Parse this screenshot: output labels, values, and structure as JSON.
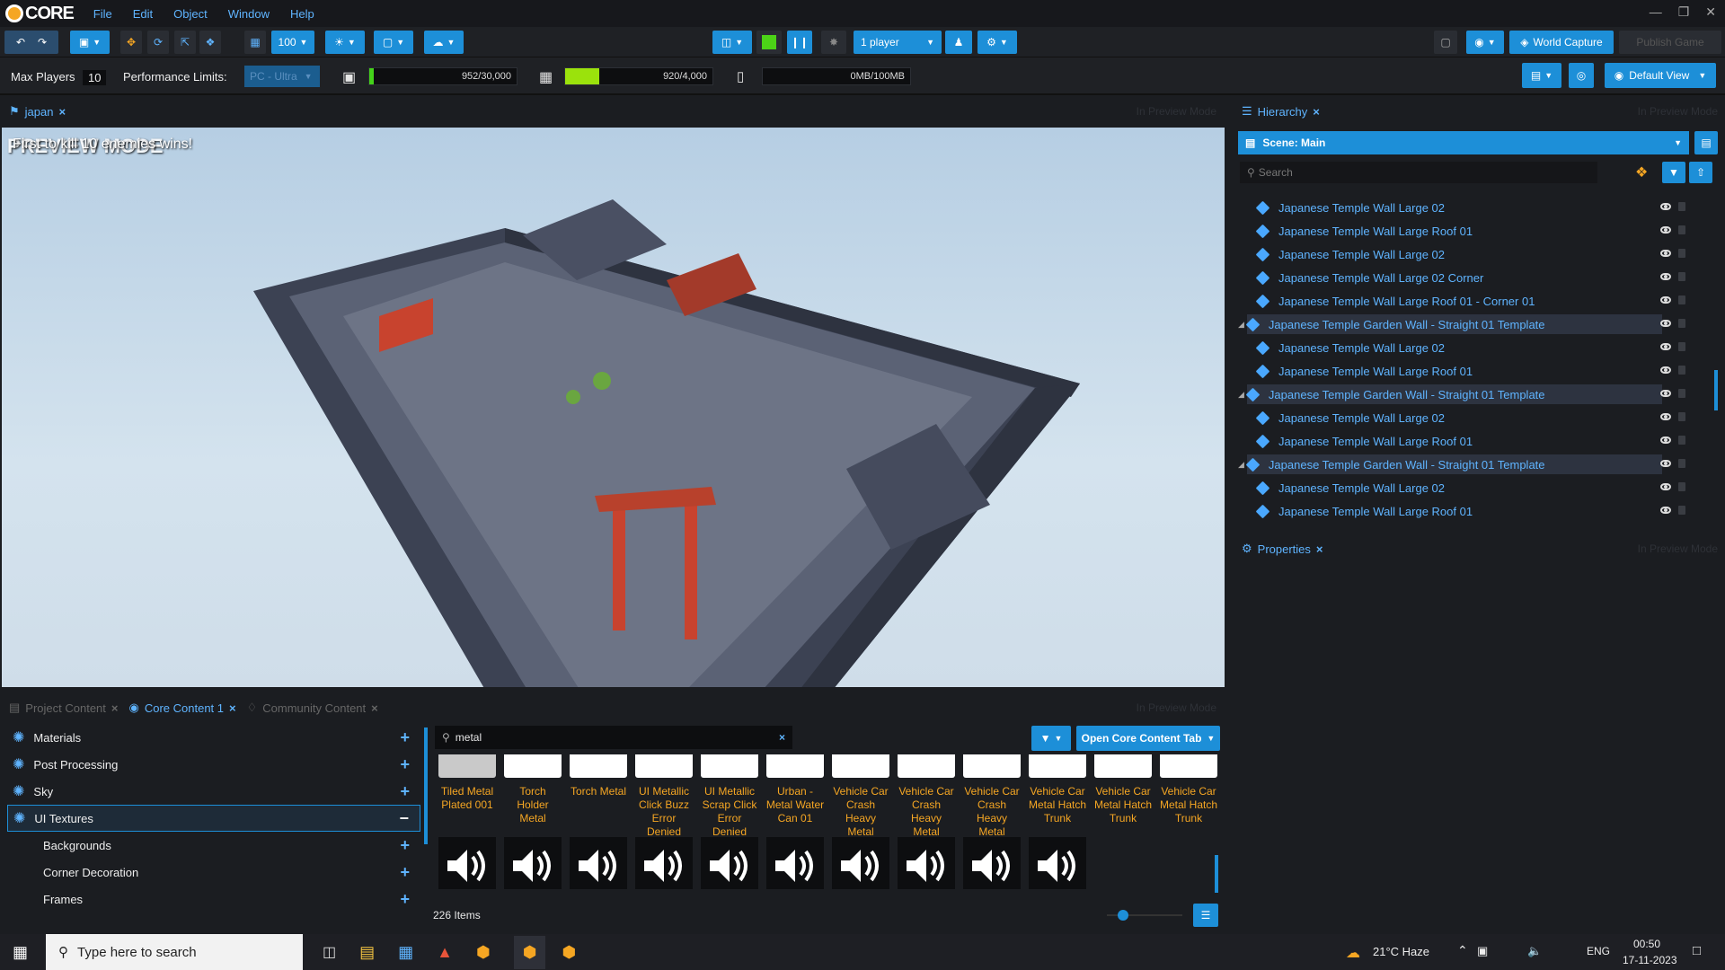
{
  "app": {
    "logo": "CORE",
    "menu": [
      "File",
      "Edit",
      "Object",
      "Window",
      "Help"
    ]
  },
  "toolbar": {
    "zoom": "100",
    "players": "1 player",
    "world_capture": "World Capture",
    "publish": "Publish Game",
    "default_view": "Default View"
  },
  "stats": {
    "max_players_label": "Max Players",
    "max_players": "10",
    "perf_label": "Performance Limits:",
    "perf_value": "PC - Ultra",
    "bars": [
      {
        "value": "952/30,000",
        "fraction": 0.032,
        "color": "#44d21a"
      },
      {
        "value": "920/4,000",
        "fraction": 0.23,
        "color": "#9be20c"
      },
      {
        "value": "0MB/100MB",
        "fraction": 0,
        "color": "#44d21a"
      }
    ]
  },
  "viewport": {
    "tab": "japan",
    "ghost": "In Preview Mode",
    "overlay": "PREVIEW MODE",
    "overlay2": "First to kill 10 enemies wins!"
  },
  "hierarchy": {
    "tab": "Hierarchy",
    "ghost": "In Preview Mode",
    "scene": "Scene: Main",
    "search_placeholder": "Search",
    "items": [
      {
        "label": "Japanese Temple Wall Large 02",
        "template": false
      },
      {
        "label": "Japanese Temple Wall Large Roof 01",
        "template": false
      },
      {
        "label": "Japanese Temple Wall Large 02",
        "template": false
      },
      {
        "label": "Japanese Temple Wall Large 02 Corner",
        "template": false
      },
      {
        "label": "Japanese Temple Wall Large Roof 01 - Corner 01",
        "template": false
      },
      {
        "label": "Japanese Temple Garden Wall - Straight 01 Template",
        "template": true
      },
      {
        "label": "Japanese Temple Wall Large 02",
        "template": false
      },
      {
        "label": "Japanese Temple Wall Large Roof 01",
        "template": false
      },
      {
        "label": "Japanese Temple Garden Wall - Straight 01 Template",
        "template": true
      },
      {
        "label": "Japanese Temple Wall Large 02",
        "template": false
      },
      {
        "label": "Japanese Temple Wall Large Roof 01",
        "template": false
      },
      {
        "label": "Japanese Temple Garden Wall - Straight 01 Template",
        "template": true
      },
      {
        "label": "Japanese Temple Wall Large 02",
        "template": false
      },
      {
        "label": "Japanese Temple Wall Large Roof 01",
        "template": false
      }
    ]
  },
  "properties": {
    "tab": "Properties",
    "ghost": "In Preview Mode"
  },
  "content": {
    "tabs": [
      "Project Content",
      "Core Content 1",
      "Community Content"
    ],
    "ghost": "In Preview Mode",
    "categories": [
      {
        "label": "Materials",
        "sign": "+",
        "indent": false
      },
      {
        "label": "Post Processing",
        "sign": "+",
        "indent": false
      },
      {
        "label": "Sky",
        "sign": "+",
        "indent": false
      },
      {
        "label": "UI Textures",
        "sign": "−",
        "indent": false
      },
      {
        "label": "Backgrounds",
        "sign": "+",
        "indent": true
      },
      {
        "label": "Corner Decoration",
        "sign": "+",
        "indent": true
      },
      {
        "label": "Frames",
        "sign": "+",
        "indent": true
      }
    ],
    "search_value": "metal",
    "open_tab": "Open Core Content Tab",
    "items_count": "226 Items",
    "tiles": [
      "Tiled Metal Plated 001",
      "Torch Holder Metal",
      "Torch Metal",
      "UI Metallic Click Buzz Error Denied",
      "UI Metallic Scrap Click Error Denied",
      "Urban - Metal Water Can 01",
      "Vehicle Car Crash Heavy Metal",
      "Vehicle Car Crash Heavy Metal",
      "Vehicle Car Crash Heavy Metal",
      "Vehicle Car Metal Hatch Trunk",
      "Vehicle Car Metal Hatch Trunk",
      "Vehicle Car Metal Hatch Trunk"
    ]
  },
  "taskbar": {
    "search": "Type here to search",
    "weather": "21°C  Haze",
    "lang": "ENG",
    "time": "00:50",
    "date": "17-11-2023"
  }
}
